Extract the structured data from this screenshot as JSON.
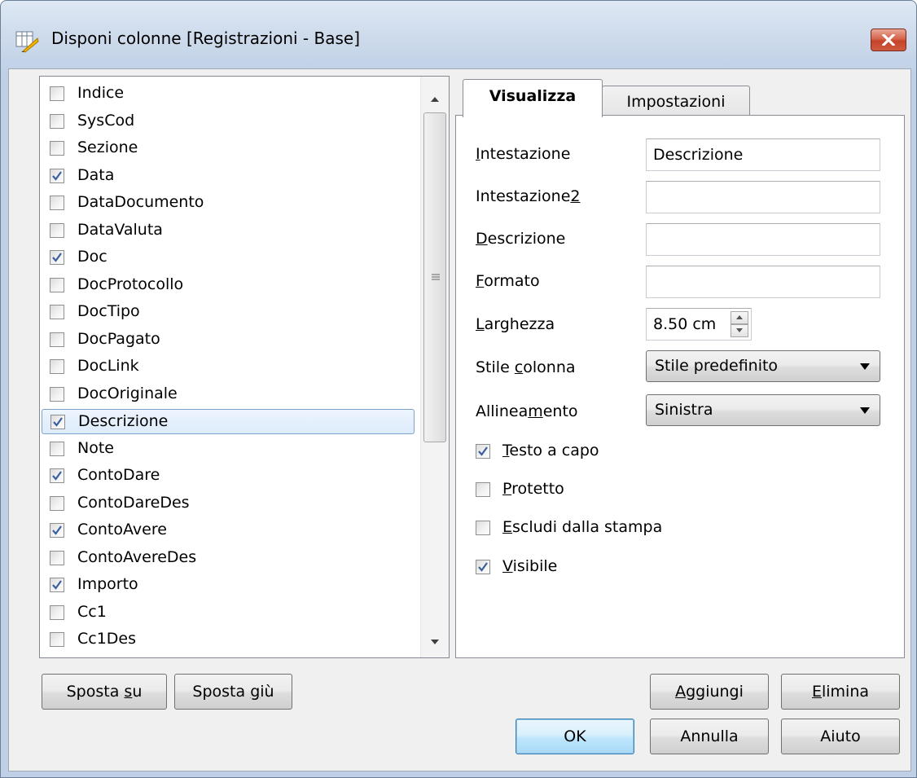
{
  "window": {
    "title": "Disponi colonne [Registrazioni - Base]",
    "close_icon": "close-icon"
  },
  "columns_list": {
    "items": [
      {
        "label": "Indice",
        "checked": false
      },
      {
        "label": "SysCod",
        "checked": false
      },
      {
        "label": "Sezione",
        "checked": false
      },
      {
        "label": "Data",
        "checked": true
      },
      {
        "label": "DataDocumento",
        "checked": false
      },
      {
        "label": "DataValuta",
        "checked": false
      },
      {
        "label": "Doc",
        "checked": true
      },
      {
        "label": "DocProtocollo",
        "checked": false
      },
      {
        "label": "DocTipo",
        "checked": false
      },
      {
        "label": "DocPagato",
        "checked": false
      },
      {
        "label": "DocLink",
        "checked": false
      },
      {
        "label": "DocOriginale",
        "checked": false
      },
      {
        "label": "Descrizione",
        "checked": true,
        "selected": true
      },
      {
        "label": "Note",
        "checked": false
      },
      {
        "label": "ContoDare",
        "checked": true
      },
      {
        "label": "ContoDareDes",
        "checked": false
      },
      {
        "label": "ContoAvere",
        "checked": true
      },
      {
        "label": "ContoAvereDes",
        "checked": false
      },
      {
        "label": "Importo",
        "checked": true
      },
      {
        "label": "Cc1",
        "checked": false
      },
      {
        "label": "Cc1Des",
        "checked": false
      }
    ]
  },
  "tabs": [
    {
      "label": "Visualizza",
      "active": true
    },
    {
      "label": "Impostazioni",
      "active": false
    }
  ],
  "settings": {
    "intestazione": {
      "label_pre": "",
      "label_u": "I",
      "label_post": "ntestazione",
      "value": "Descrizione"
    },
    "intestazione2": {
      "label_pre": "Intestazione",
      "label_u": "2",
      "label_post": "",
      "value": ""
    },
    "descrizione": {
      "label_pre": "",
      "label_u": "D",
      "label_post": "escrizione",
      "value": ""
    },
    "formato": {
      "label_pre": "",
      "label_u": "F",
      "label_post": "ormato",
      "value": ""
    },
    "larghezza": {
      "label_pre": "",
      "label_u": "L",
      "label_post": "arghezza",
      "value": "8.50 cm"
    },
    "stile_colonna": {
      "label_pre": "Stile ",
      "label_u": "c",
      "label_post": "olonna",
      "value": "Stile predefinito"
    },
    "allineamento": {
      "label_pre": "Allinea",
      "label_u": "m",
      "label_post": "ento",
      "value": "Sinistra"
    },
    "testo_a_capo": {
      "label_pre": "",
      "label_u": "T",
      "label_post": "esto a capo",
      "checked": true
    },
    "protetto": {
      "label_pre": "",
      "label_u": "P",
      "label_post": "rotetto",
      "checked": false
    },
    "escludi_stampa": {
      "label_pre": "",
      "label_u": "E",
      "label_post": "scludi dalla stampa",
      "checked": false
    },
    "visibile": {
      "label_pre": "",
      "label_u": "V",
      "label_post": "isibile",
      "checked": true
    }
  },
  "buttons": {
    "sposta_su": {
      "pre": "Sposta ",
      "u": "s",
      "post": "u"
    },
    "sposta_giu": {
      "pre": "Sposta ",
      "u": "g",
      "post": "iù"
    },
    "aggiungi": {
      "pre": "",
      "u": "A",
      "post": "ggiungi"
    },
    "elimina": {
      "pre": "",
      "u": "E",
      "post": "limina"
    },
    "ok": "OK",
    "annulla": "Annulla",
    "aiuto": "Aiuto"
  },
  "colors": {
    "client_bg": "#f0f0f0",
    "selection_border": "#7da2ce",
    "check_mark": "#3a5f9e",
    "close_button": "#c6432a"
  }
}
